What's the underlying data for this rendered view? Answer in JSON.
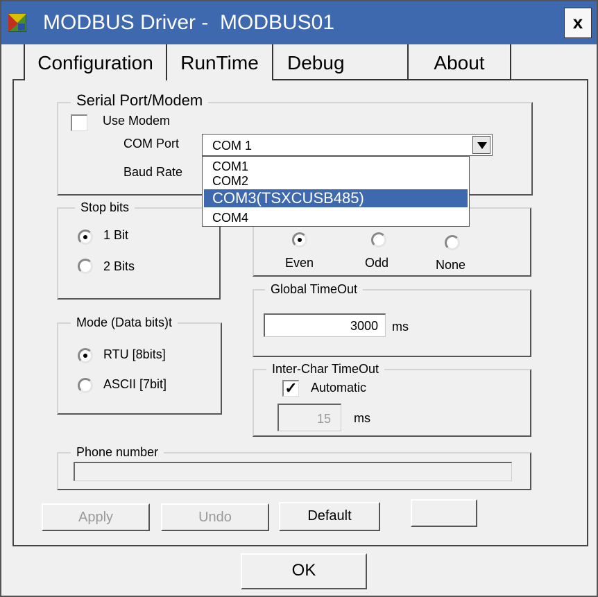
{
  "window": {
    "title": "MODBUS Driver -  MODBUS01",
    "close_label": "x"
  },
  "tabs": [
    {
      "label": "Configuration"
    },
    {
      "label": "RunTime"
    },
    {
      "label": "Debug"
    },
    {
      "label": "About"
    }
  ],
  "serial": {
    "group_title": "Serial Port/Modem",
    "use_modem_label": "Use Modem",
    "use_modem_checked": false,
    "com_port_label": "COM Port",
    "com_port_value": "COM 1",
    "baud_rate_label": "Baud Rate",
    "dropdown_options": [
      "COM1",
      "COM2",
      "COM3(TSXCUSB485)",
      "COM4"
    ],
    "highlighted_option": "COM3(TSXCUSB485)"
  },
  "stop_bits": {
    "group_title": "Stop bits",
    "options": [
      "1 Bit",
      "2 Bits"
    ],
    "selected": "1 Bit"
  },
  "parity": {
    "options": [
      "Even",
      "Odd",
      "None"
    ],
    "selected": "Even"
  },
  "mode": {
    "group_title": "Mode (Data bits)t",
    "options": [
      "RTU [8bits]",
      "ASCII [7bit]"
    ],
    "selected": "RTU [8bits]"
  },
  "global_timeout": {
    "group_title": "Global TimeOut",
    "value": "3000",
    "unit": "ms"
  },
  "inter_char": {
    "group_title": "Inter-Char TimeOut",
    "automatic_label": "Automatic",
    "automatic_checked": true,
    "check_mark": "✓",
    "value": "15",
    "unit": "ms"
  },
  "phone": {
    "group_title": "Phone number",
    "value": ""
  },
  "buttons": {
    "apply": "Apply",
    "undo": "Undo",
    "default": "Default",
    "ok": "OK"
  },
  "colors": {
    "title_bar": "#3f69ae",
    "highlight": "#3f69ae",
    "background": "#f0f0f0"
  }
}
